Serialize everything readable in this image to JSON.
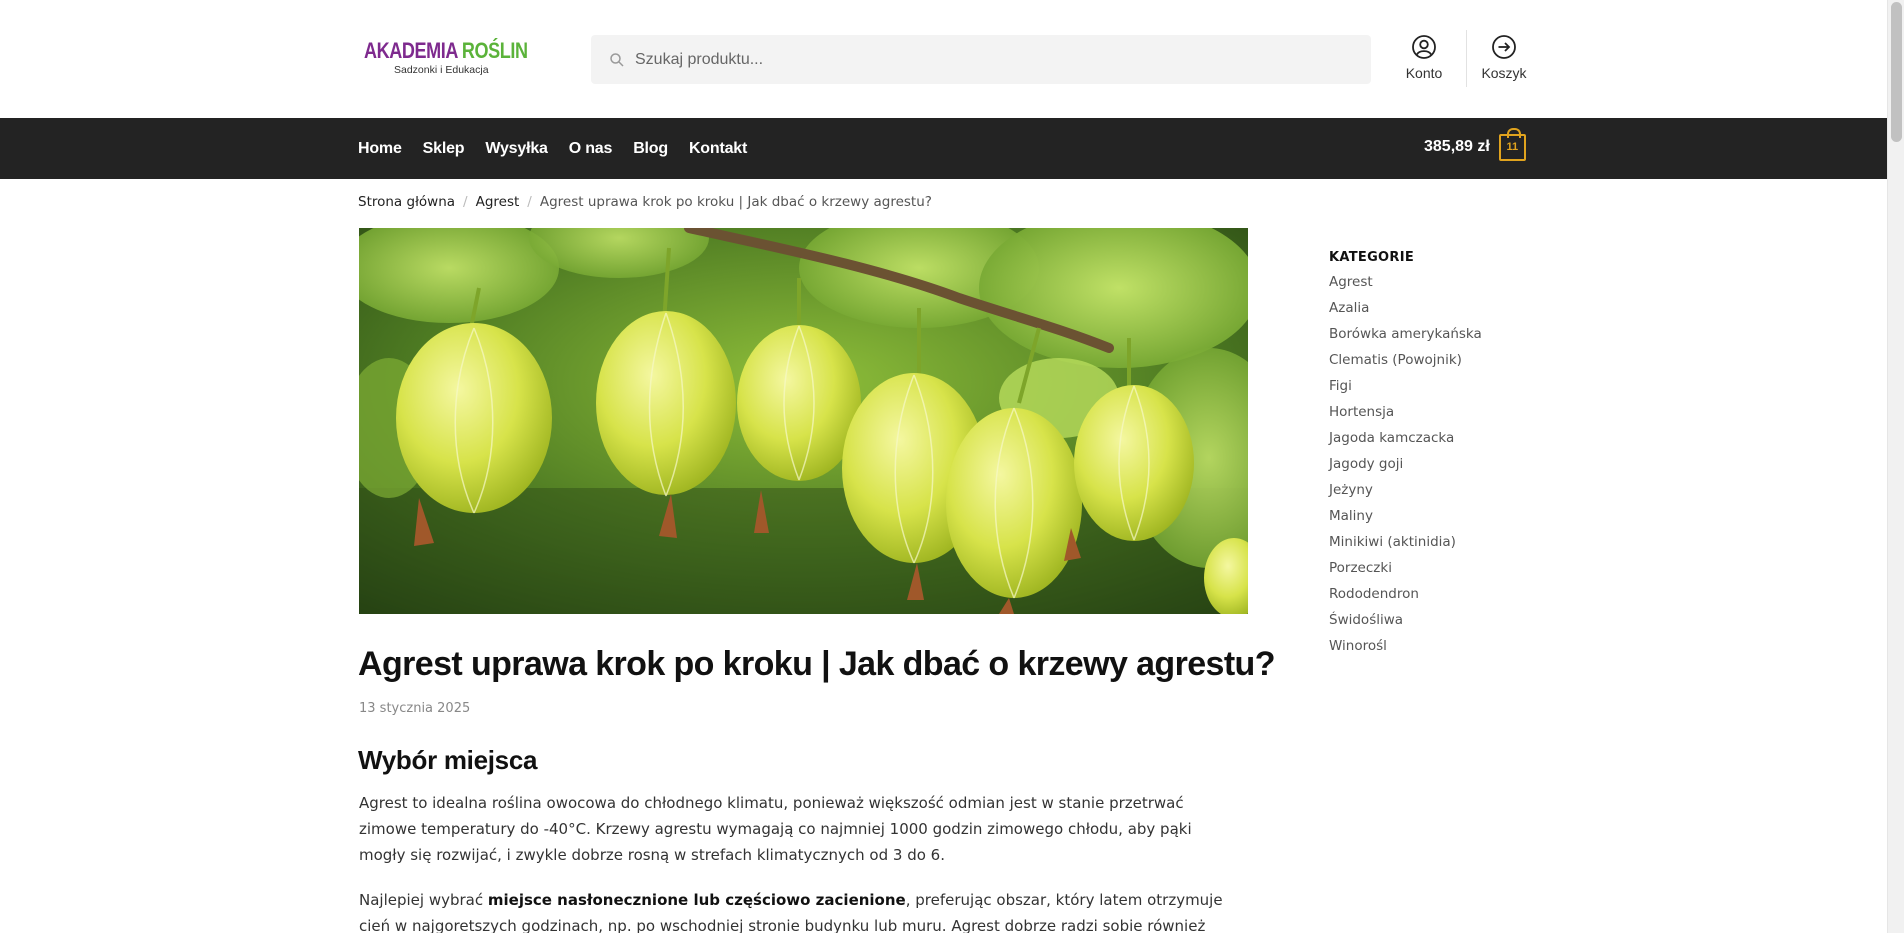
{
  "header": {
    "logo_title_part1": "AKADEMIA",
    "logo_title_part2": "ROŚLIN",
    "logo_subtitle": "Sadzonki i Edukacja",
    "search_placeholder": "Szukaj produktu...",
    "account_label": "Konto",
    "cart_label": "Koszyk"
  },
  "nav": {
    "items": [
      "Home",
      "Sklep",
      "Wysyłka",
      "O nas",
      "Blog",
      "Kontakt"
    ],
    "cart_amount": "385,89 zł",
    "cart_count": "11"
  },
  "breadcrumb": {
    "home": "Strona główna",
    "category": "Agrest",
    "current": "Agrest uprawa krok po kroku | Jak dbać o krzewy agrestu?"
  },
  "article": {
    "title": "Agrest uprawa krok po kroku | Jak dbać o krzewy agrestu?",
    "date": "13 stycznia 2025",
    "section_heading": "Wybór miejsca",
    "paragraph1": "Agrest to idealna roślina owocowa do chłodnego klimatu, ponieważ większość odmian jest w stanie przetrwać zimowe temperatury do -40°C. Krzewy agrestu wymagają co najmniej 1000 godzin zimowego chłodu, aby pąki mogły się rozwijać, i zwykle dobrze rosną w strefach klimatycznych od 3 do 6.",
    "paragraph2_before": "Najlepiej wybrać ",
    "paragraph2_bold": "miejsce nasłonecznione lub częściowo zacienione",
    "paragraph2_after": ", preferując obszar, który latem otrzymuje cień w najgoretszych godzinach, np. po wschodniej stronie budynku lub muru. Agrest dobrze radzi sobie również jako roślina"
  },
  "sidebar": {
    "heading": "KATEGORIE",
    "categories": [
      "Agrest",
      "Azalia",
      "Borówka amerykańska",
      "Clematis (Powojnik)",
      "Figi",
      "Hortensja",
      "Jagoda kamczacka",
      "Jagody goji",
      "Jeżyny",
      "Maliny",
      "Minikiwi (aktinidia)",
      "Porzeczki",
      "Rododendron",
      "Świdośliwa",
      "Winorośl"
    ]
  },
  "colors": {
    "brand_purple": "#7e2a8e",
    "brand_green": "#5bb33a",
    "nav_bg": "#232323",
    "cart_accent": "#e0a31e"
  }
}
